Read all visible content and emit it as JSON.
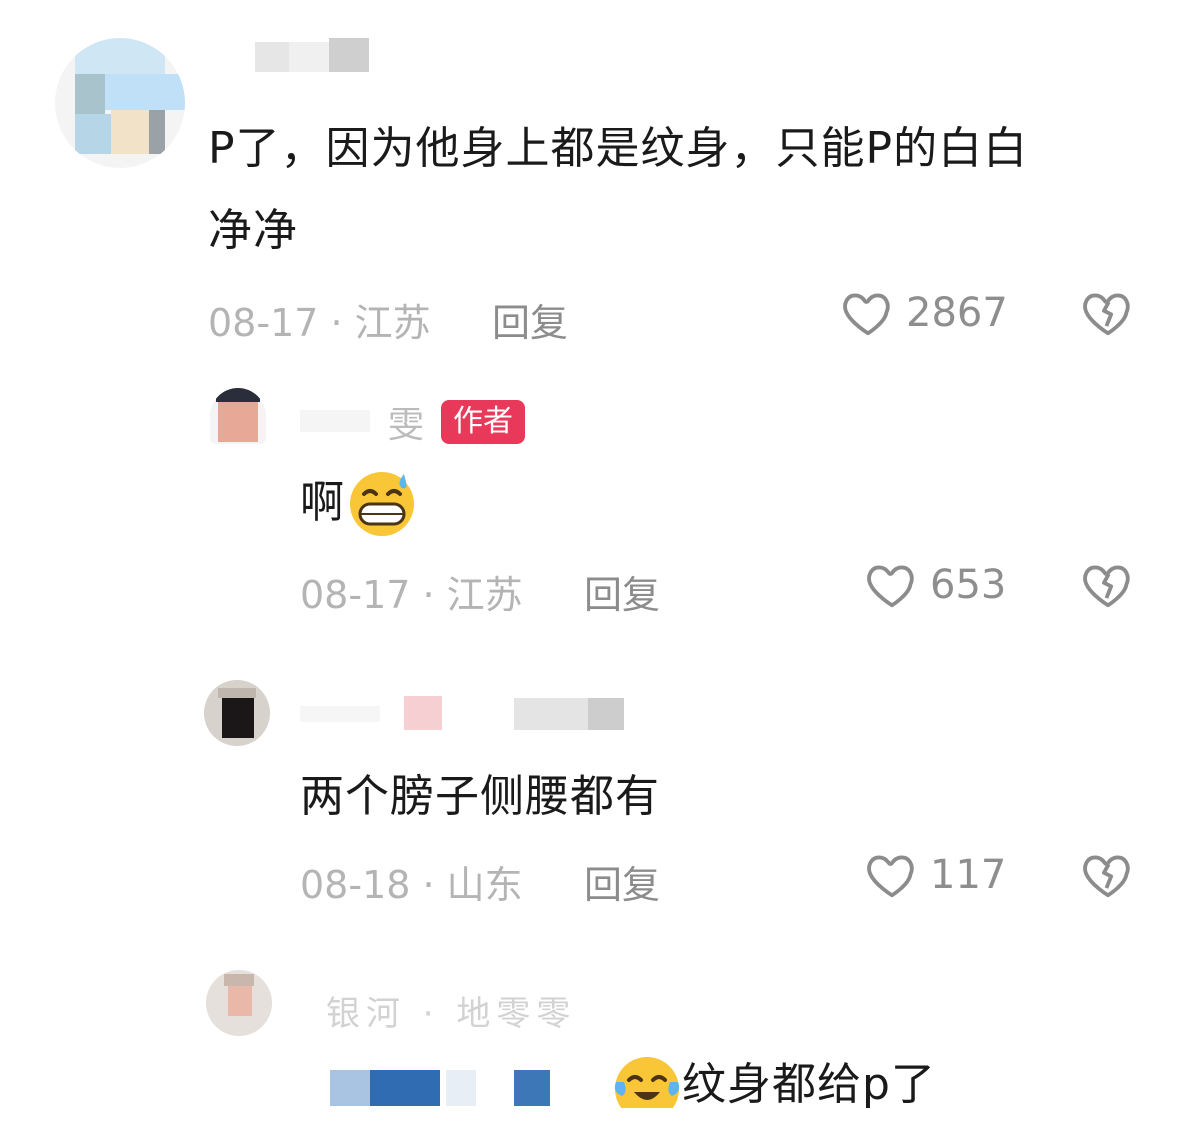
{
  "comments": [
    {
      "text_line1": "P了，因为他身上都是纹身，只能P的白白",
      "text_line2": "净净",
      "date_location": "08-17 · 江苏",
      "reply_label": "回复",
      "likes": "2867"
    },
    {
      "author_badge": "作者",
      "name_partial": "雯",
      "text": "啊",
      "emoji_icon": "grinning-sweat-icon",
      "date_location": "08-17 · 江苏",
      "reply_label": "回复",
      "likes": "653"
    },
    {
      "text": "两个膀子侧腰都有",
      "date_location": "08-18 · 山东",
      "reply_label": "回复",
      "likes": "117"
    },
    {
      "name_partial": "银河 · 地零零",
      "text": "纹身都给p了",
      "emoji_icon": "crying-laughing-icon"
    }
  ],
  "icons": {
    "like": "heart-outline-icon",
    "dislike": "broken-heart-icon"
  },
  "colors": {
    "badge": "#e8395a",
    "meta": "#b4b4b4",
    "text": "#1a1a1a"
  }
}
